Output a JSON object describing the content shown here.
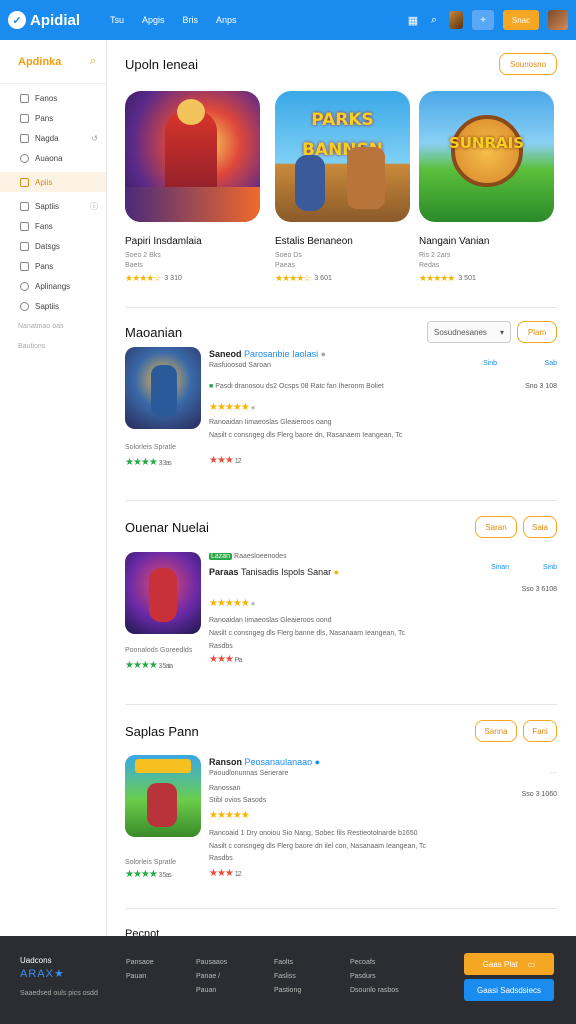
{
  "app": {
    "name": "Apidial",
    "logo_mark": "✓"
  },
  "topnav": [
    "Tsu",
    "Apgis",
    "Bris",
    "Anps"
  ],
  "topbar": {
    "action_label": "Snac",
    "icons": [
      "grid-icon",
      "search-icon",
      "avatar",
      "plus-icon"
    ]
  },
  "sidebar": {
    "title": "Apdinka",
    "items": [
      {
        "label": "Fanos",
        "icon": "file-icon",
        "right": ""
      },
      {
        "label": "Pans",
        "icon": "file-icon",
        "right": ""
      },
      {
        "label": "Nagda",
        "icon": "file-icon",
        "right": "↺"
      },
      {
        "label": "Auaona",
        "icon": "clock-icon",
        "right": ""
      },
      {
        "label": "Apiis",
        "icon": "app-icon",
        "right": "",
        "active": true
      },
      {
        "label": "Saptiis",
        "icon": "list-icon",
        "right": "ⓘ"
      },
      {
        "label": "Fans",
        "icon": "file-icon",
        "right": ""
      },
      {
        "label": "Datsgs",
        "icon": "doc-icon",
        "right": ""
      },
      {
        "label": "Pans",
        "icon": "file-icon",
        "right": ""
      },
      {
        "label": "Aplinangs",
        "icon": "user-icon",
        "right": ""
      },
      {
        "label": "Saptiis",
        "icon": "gear-icon",
        "right": ""
      }
    ],
    "muted": [
      "Nanatmao oas",
      "Bautions"
    ]
  },
  "featured": {
    "title": "Upoln Ieneai",
    "button": "Sounosno",
    "items": [
      {
        "title": "Papiri Insdamlaia",
        "sub": "Soeo 2 Bks",
        "sub2": "Baets",
        "rating": "3 310"
      },
      {
        "title": "Estalis Benaneon",
        "sub": "Soeo Ds",
        "sub2": "Paeas",
        "rating": "3 601"
      },
      {
        "title": "Nangain Vanian",
        "sub": "Ris 2 2ars",
        "sub2": "Redas",
        "rating": "3 501"
      }
    ],
    "banner_texts": [
      "",
      "PARKS BANNSN",
      "SUNRAIS"
    ]
  },
  "sections": [
    {
      "title": "Maoanian",
      "dropdown": "Sosudnesanes",
      "button": "Plam",
      "row": {
        "title": "Saneod",
        "title_accent": "Parosanbie Iaolasi",
        "lines": [
          "Rasfuoosod Saroan",
          "Pasdi dranosou ds2 Ocsps 08 Ratc fan Iheronm Boliet"
        ],
        "desc": [
          "Ranoaidan Iimaeoslas Gleaieroos oang",
          "Nasilt c consngeg dls Flerg baore dn, Rasanaem Ieangean, Tc"
        ],
        "right1": "Sinb",
        "right2": "Sab",
        "right3": "Sno 3 108",
        "left_caption": "Solorleis Spratle",
        "green_rating": "3 3as",
        "red_rating": "12"
      }
    },
    {
      "title": "Ouenar Nuelai",
      "button": "Saran",
      "button2": "Saia",
      "row": {
        "badge": "Lazan",
        "badge_text": "Raaesloeenodes",
        "title": "Paraas",
        "title_accent": "Tanisadis Ispols Sanar",
        "lines": [],
        "desc": [
          "Ranoaidan Iimaeoslas Gleaieroos oond",
          "Nasilt c consngeg dls Flerg banne dls, Nasanaam Ieangean, Tc",
          "Rasdbs"
        ],
        "right1": "Sinan",
        "right2": "Sinb",
        "right3": "Sso 3 6108",
        "left_caption": "Poonalods Goreedlds",
        "green_rating": "3 5ata",
        "red_rating": "Pa"
      }
    },
    {
      "title": "Saplas Pann",
      "button": "Sanna",
      "button2": "Fani",
      "row": {
        "title": "Ranson",
        "title_accent": "Peosanaulanaao",
        "lines": [
          "Paoudlonunnas Senerare",
          "Ranossan",
          "Stibl ovios Sasods"
        ],
        "desc": [
          "Rancoaid 1 Dry onoiou Sio Nang, Sobec fils Restieotolnarde b1650",
          "Nasilt c consngeg dls Flerg baore dn ilel con, Nasanaam Ieangean, Tc",
          "Rasdbs"
        ],
        "right1": "",
        "right2": "",
        "right3": "Sso 3 1060",
        "left_caption": "Solorleis Spratle",
        "green_rating": "3 5as",
        "red_rating": "12"
      }
    }
  ],
  "fourth_title": "Pecnot",
  "footer": {
    "brand": "Uadcons",
    "stars": "ARAX★",
    "copy": "Saaedsed ouls pics osdd",
    "cols": [
      [
        "Pansaoe",
        "Pauan"
      ],
      [
        "Pausaaos",
        "Panae /",
        "Pauan"
      ],
      [
        "Faolts",
        "Fasliss",
        "Pastiong"
      ],
      [
        "Pecoafs",
        "Pasdurs",
        "Dsounlo rasbos"
      ]
    ],
    "btn1": "Gaas  Plat",
    "btn2": "Gaasi   Sadsdsiecs"
  },
  "colors": {
    "accent": "#1a8cf0",
    "orange": "#f5a623",
    "dark": "#2b2d33"
  }
}
